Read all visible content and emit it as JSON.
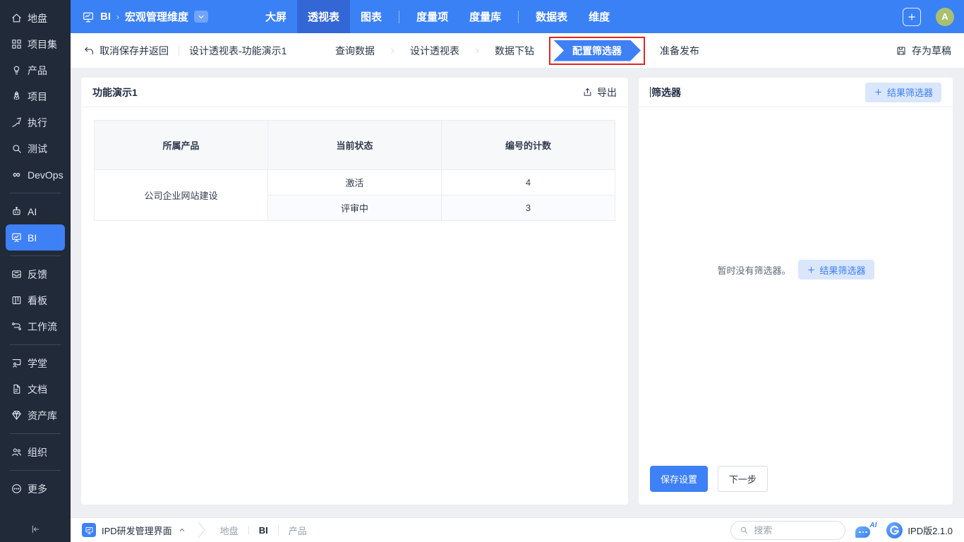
{
  "colors": {
    "accent": "#3b81f6",
    "sidebar_bg": "#212a39",
    "avatar_bg": "#a9c16f",
    "annotation_red": "#e2261f"
  },
  "sidebar": {
    "items": [
      {
        "label": "地盘",
        "icon": "home"
      },
      {
        "label": "项目集",
        "icon": "project-set"
      },
      {
        "label": "产品",
        "icon": "product"
      },
      {
        "label": "项目",
        "icon": "project"
      },
      {
        "label": "执行",
        "icon": "execute"
      },
      {
        "label": "测试",
        "icon": "test"
      },
      {
        "label": "DevOps",
        "icon": "devops"
      },
      {
        "label": "AI",
        "icon": "ai"
      },
      {
        "label": "BI",
        "icon": "bi",
        "active": true
      },
      {
        "label": "反馈",
        "icon": "feedback"
      },
      {
        "label": "看板",
        "icon": "kanban"
      },
      {
        "label": "工作流",
        "icon": "workflow"
      },
      {
        "label": "学堂",
        "icon": "school"
      },
      {
        "label": "文档",
        "icon": "document"
      },
      {
        "label": "资产库",
        "icon": "asset"
      },
      {
        "label": "组织",
        "icon": "org"
      },
      {
        "label": "更多",
        "icon": "more"
      }
    ]
  },
  "topbar": {
    "breadcrumb_root": "BI",
    "breadcrumb_current": "宏观管理维度",
    "nav": [
      {
        "label": "大屏"
      },
      {
        "label": "透视表",
        "active": true
      },
      {
        "label": "图表"
      },
      {
        "label": "度量项"
      },
      {
        "label": "度量库"
      },
      {
        "label": "数据表"
      },
      {
        "label": "维度"
      }
    ],
    "avatar_text": "A"
  },
  "toolbar": {
    "back": "取消保存并返回",
    "title": "设计透视表-功能演示1",
    "steps": [
      "查询数据",
      "设计透视表",
      "数据下钻",
      "配置筛选器",
      "准备发布"
    ],
    "active_step": "配置筛选器",
    "save_draft": "存为草稿"
  },
  "pivot": {
    "title": "功能演示1",
    "export_label": "导出",
    "table": {
      "headers": [
        "所属产品",
        "当前状态",
        "编号的计数"
      ],
      "product": "公司企业网站建设",
      "rows": [
        {
          "status": "激活",
          "count": "4"
        },
        {
          "status": "评审中",
          "count": "3"
        }
      ]
    }
  },
  "filter": {
    "title": "筛选器",
    "add_button": "结果筛选器",
    "empty_text": "暂时没有筛选器。",
    "empty_button": "结果筛选器",
    "save_button": "保存设置",
    "next_button": "下一步"
  },
  "footer": {
    "app_name": "IPD研发管理界面",
    "crumbs": [
      "地盘",
      "BI",
      "产品"
    ],
    "search_placeholder": "搜索",
    "ai_badge": "AI",
    "version": "IPD版2.1.0"
  }
}
